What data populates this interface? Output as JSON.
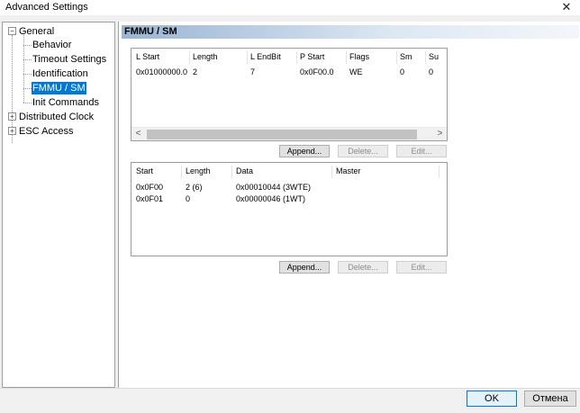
{
  "window": {
    "title": "Advanced Settings",
    "close_glyph": "✕"
  },
  "tree": {
    "items": [
      {
        "label": "General",
        "expander": "−"
      },
      {
        "label": "Behavior"
      },
      {
        "label": "Timeout Settings"
      },
      {
        "label": "Identification"
      },
      {
        "label": "FMMU / SM",
        "selected": true
      },
      {
        "label": "Init Commands"
      },
      {
        "label": "Distributed Clock",
        "expander": "+"
      },
      {
        "label": "ESC Access",
        "expander": "+"
      }
    ]
  },
  "section": {
    "title": "FMMU / SM"
  },
  "fmmu_table": {
    "columns": [
      "L Start",
      "Length",
      "L EndBit",
      "P Start",
      "Flags",
      "Sm",
      "Su"
    ],
    "rows": [
      [
        "0x01000000.0",
        "2",
        "7",
        "0x0F00.0",
        "WE",
        "0",
        "0"
      ]
    ],
    "scroll_left": "<",
    "scroll_right": ">"
  },
  "fmmu_buttons": {
    "append": "Append...",
    "delete": "Delete...",
    "edit": "Edit..."
  },
  "sm_table": {
    "columns": [
      "Start",
      "Length",
      "Data",
      "Master"
    ],
    "rows": [
      [
        "0x0F00",
        "2 (6)",
        "0x00010044 (3WTE)",
        ""
      ],
      [
        "0x0F01",
        "0",
        "0x00000046 (1WT)",
        ""
      ]
    ]
  },
  "sm_buttons": {
    "append": "Append...",
    "delete": "Delete...",
    "edit": "Edit..."
  },
  "dialog": {
    "ok": "OK",
    "cancel": "Отмена"
  }
}
